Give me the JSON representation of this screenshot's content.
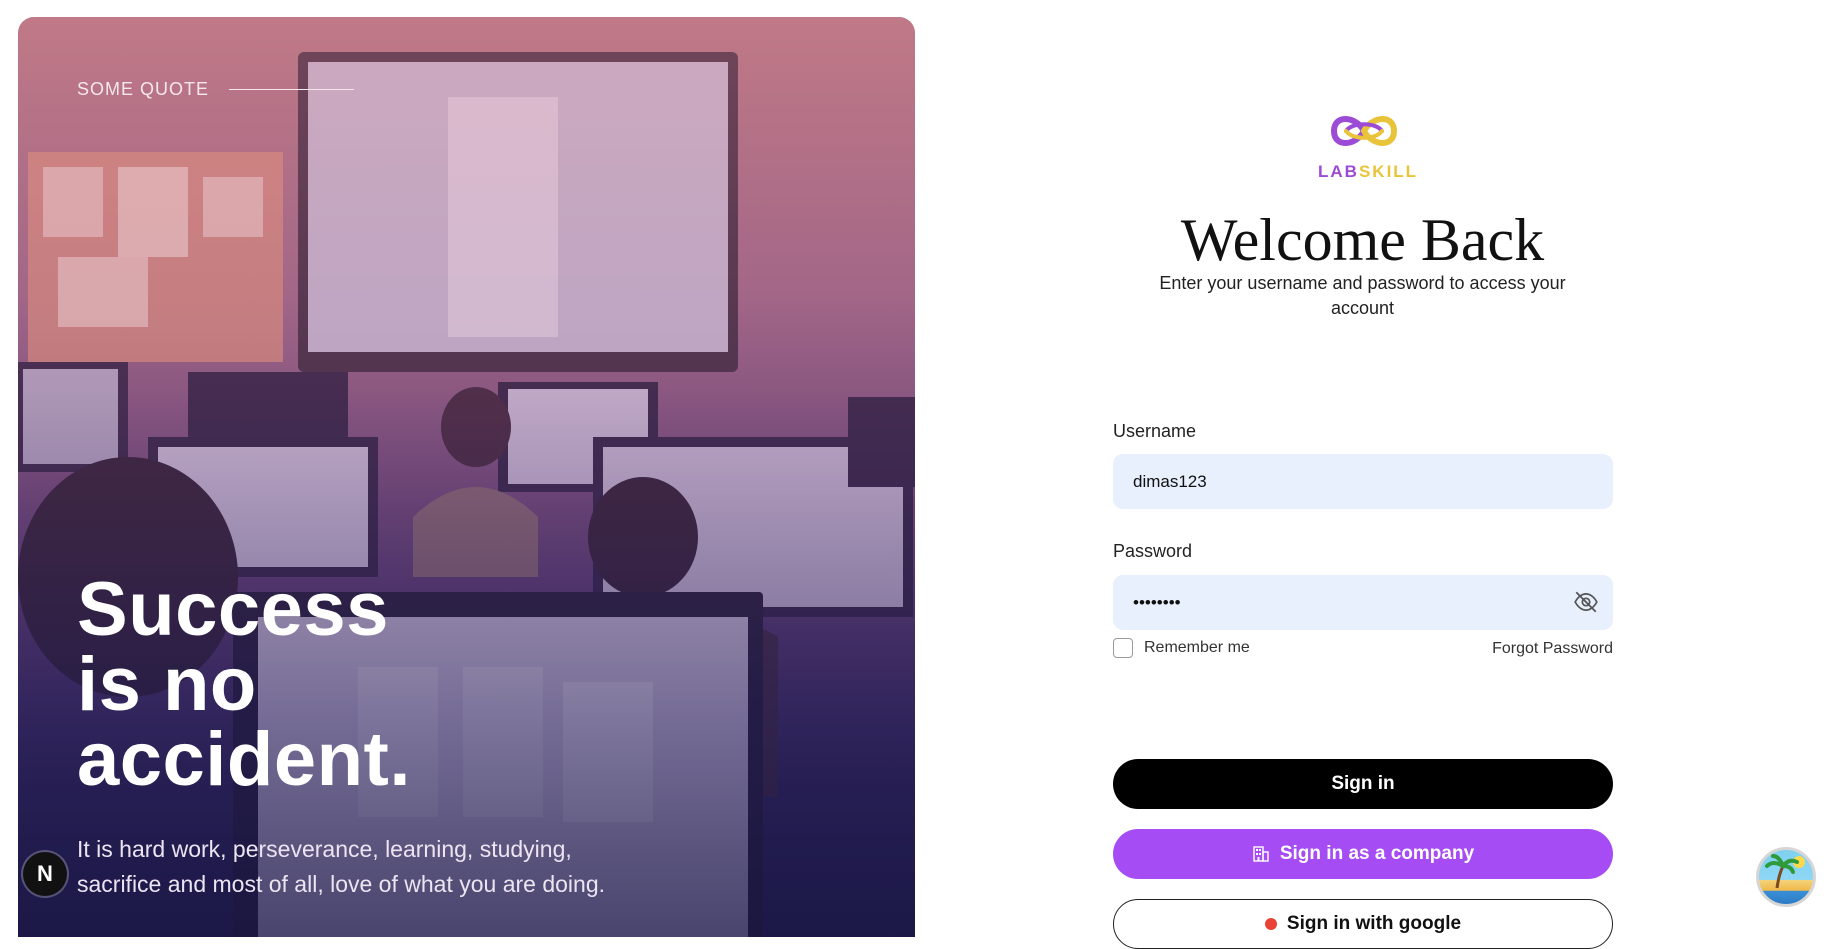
{
  "hero": {
    "quote_label": "SOME QUOTE",
    "headline": [
      "Success",
      "is no",
      "accident."
    ],
    "tagline": "It is hard work, perseverance, learning, studying, sacrifice and most of all, love of what you are doing."
  },
  "badge": {
    "letter": "N"
  },
  "logo": {
    "lab": "LAB",
    "skill": "SKILL",
    "colors": {
      "purple": "#9b4bd6",
      "yellow": "#e9c43a"
    }
  },
  "form": {
    "title": "Welcome Back",
    "subtitle": "Enter your username and password to access your account",
    "username_label": "Username",
    "username_value": "dimas123",
    "password_label": "Password",
    "password_value": "••••••••",
    "remember_label": "Remember me",
    "forgot_label": "Forgot Password",
    "signin_label": "Sign in",
    "company_label": "Sign in as a company",
    "google_label": "Sign in with google"
  },
  "colors": {
    "primary_button": "#000000",
    "company_button": "#a64cf5",
    "field_bg": "#e8effd"
  }
}
